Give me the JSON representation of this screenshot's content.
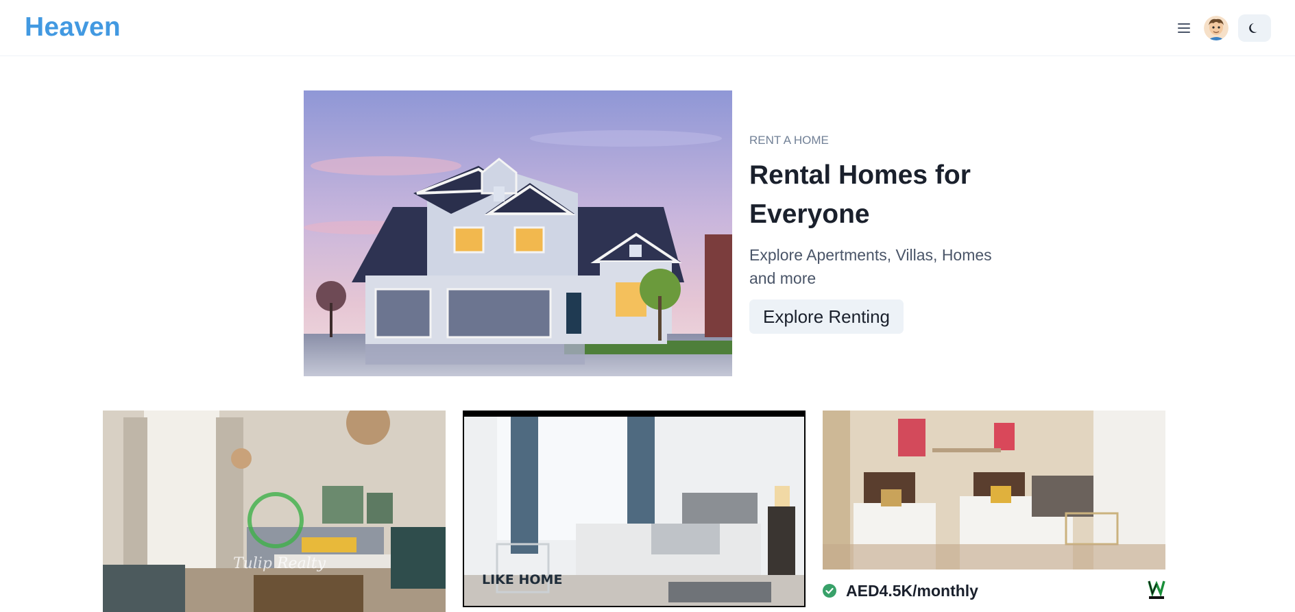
{
  "header": {
    "brand": "Heaven",
    "menu_icon": "hamburger-menu-icon",
    "avatar_icon": "user-avatar",
    "theme_toggle_icon": "moon-icon"
  },
  "hero": {
    "eyebrow": "RENT A HOME",
    "title": "Rental Homes for Everyone",
    "subtitle": "Explore Apertments, Villas, Homes and more",
    "cta_label": "Explore Renting"
  },
  "listings": [
    {
      "watermark": "Tulip Realty"
    },
    {
      "watermark": "LIKE HOME"
    },
    {
      "price": "AED4.5K/monthly",
      "status_icon": "verified-check-icon",
      "agency_logo": "W"
    }
  ],
  "colors": {
    "brand": "#4299e1",
    "button_bg": "#edf2f7",
    "verified": "#38a169"
  }
}
